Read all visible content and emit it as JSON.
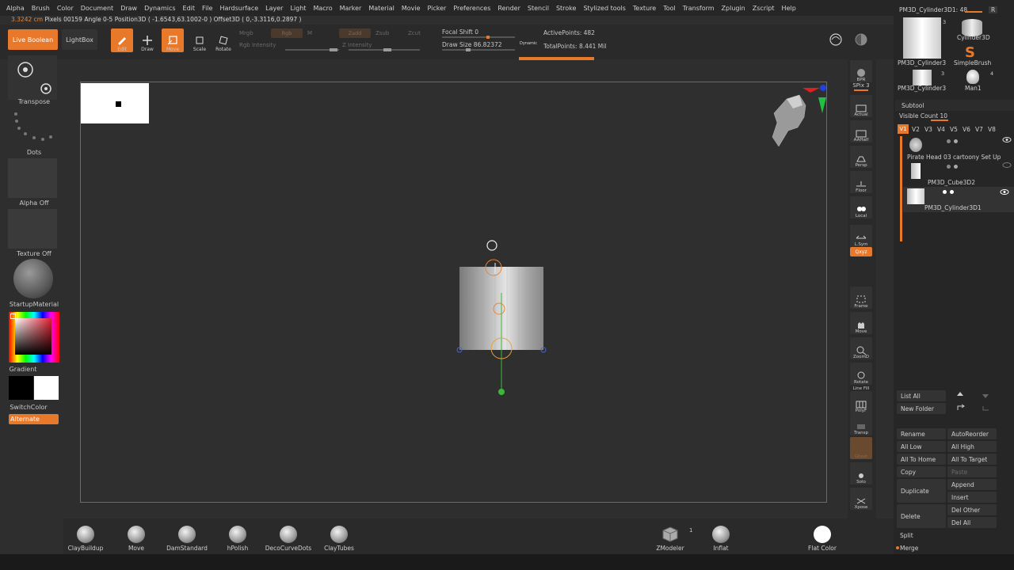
{
  "menu": [
    "Alpha",
    "Brush",
    "Color",
    "Document",
    "Draw",
    "Dynamics",
    "Edit",
    "File",
    "Hardsurface",
    "Layer",
    "Light",
    "Macro",
    "Marker",
    "Material",
    "Movie",
    "Picker",
    "Preferences",
    "Render",
    "Stencil",
    "Stroke",
    "Stylized tools",
    "Texture",
    "Tool",
    "Transform",
    "Zplugin",
    "Zscript",
    "Help"
  ],
  "info": {
    "size": "3.3242 cm",
    "rest": "Pixels 00159 Angle 0-5 Position3D ( -1.6543,63.1002-0 ) Offset3D ( 0,-3.3116,0.2897 )"
  },
  "top": {
    "live_boolean": "Live Boolean",
    "lightbox": "LightBox",
    "edit": "Edit",
    "draw": "Draw",
    "move": "Move",
    "scale": "Scale",
    "rotate": "Rotate",
    "mrgb": "Mrgb",
    "rgb": "Rgb",
    "m": "M",
    "rgb_intensity": "Rgb Intensity",
    "zadd": "Zadd",
    "zsub": "Zsub",
    "zcut": "Zcut",
    "z_intensity": "Z Intensity",
    "focal_shift": "Focal Shift 0",
    "draw_size": "Draw Size 86.82372",
    "dynamic": "Dynamic",
    "active_points": "ActivePoints: 482",
    "total_points": "TotalPoints: 8.441 Mil"
  },
  "left": {
    "transpose": "Transpose",
    "dots": "Dots",
    "alpha": "Alpha Off",
    "texture": "Texture Off",
    "material": "StartupMaterial",
    "gradient": "Gradient",
    "switchcolor": "SwitchColor",
    "alternate": "Alternate"
  },
  "right_tools": [
    "BPR",
    "SPix 3",
    "Actual",
    "AAHalf",
    "Persp",
    "Floor",
    "Local",
    "L.Sym",
    "Qxyz",
    "Frame",
    "Move",
    "ZoomD",
    "Rotate",
    "Line Fill",
    "PolyF",
    "Transp",
    "Ghost",
    "Solo",
    "Xpose"
  ],
  "panel": {
    "tool_name": "PM3D_Cylinder3D1: 48",
    "r": "R",
    "thumbs": [
      "PM3D_Cylinder3",
      "Cylinder3D",
      "SimpleBrush",
      "PM3D_Cylinder3",
      "Man1"
    ],
    "thumb_nums": [
      "3",
      "3",
      "4"
    ],
    "subtool": "Subtool",
    "visible_count": "Visible Count 10",
    "versions": [
      "V1",
      "V2",
      "V3",
      "V4",
      "V5",
      "V6",
      "V7",
      "V8"
    ],
    "subtools": [
      "Pirate Head 03 cartoony Set Up",
      "PM3D_Cube3D2",
      "PM3D_Cylinder3D1"
    ],
    "list_all": "List All",
    "new_folder": "New Folder",
    "rename": "Rename",
    "autoreorder": "AutoReorder",
    "all_low": "All Low",
    "all_high": "All High",
    "all_to_home": "All To Home",
    "all_to_target": "All To Target",
    "copy": "Copy",
    "paste": "Paste",
    "duplicate": "Duplicate",
    "append": "Append",
    "insert": "Insert",
    "del_other": "Del Other",
    "delete": "Delete",
    "del_all": "Del All",
    "split": "Split",
    "merge": "Merge"
  },
  "brushes": [
    "ClayBuildup",
    "Move",
    "DamStandard",
    "hPolish",
    "DecoCurveDots",
    "ClayTubes"
  ],
  "bottom_right": {
    "zmodeler": "ZModeler",
    "zmodeler_num": "1",
    "inflat": "Inflat",
    "flat_color": "Flat Color"
  },
  "colors": {
    "accent": "#e8782a",
    "bg": "#2e2e2e"
  }
}
